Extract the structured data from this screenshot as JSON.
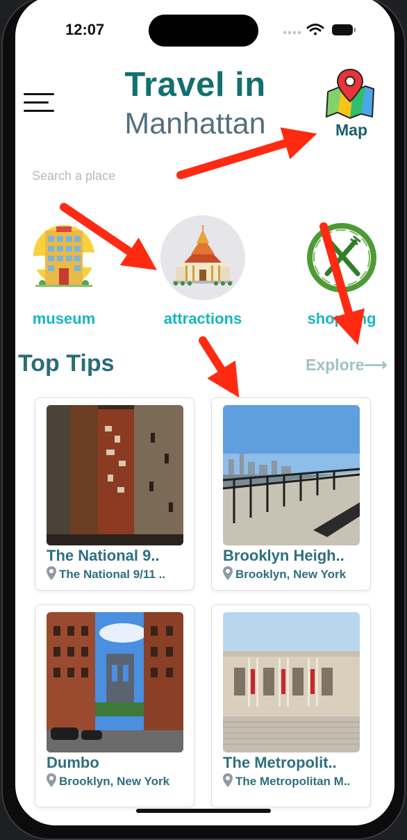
{
  "status": {
    "time": "12:07"
  },
  "header": {
    "title_line1": "Travel in",
    "title_line2": "Manhattan",
    "map_label": "Map"
  },
  "search": {
    "placeholder": "Search a place",
    "value": ""
  },
  "categories": [
    {
      "label": "museum",
      "icon": "hotel-icon"
    },
    {
      "label": "attractions",
      "icon": "temple-icon"
    },
    {
      "label": "shopping",
      "icon": "fork-knife-icon"
    }
  ],
  "section": {
    "title": "Top Tips",
    "explore": "Explore⟶"
  },
  "cards": [
    {
      "name": "The National 9..",
      "location": "The National 9/11 .."
    },
    {
      "name": "Brooklyn Heigh..",
      "location": "Brooklyn, New York"
    },
    {
      "name": "Dumbo",
      "location": "Brooklyn, New York"
    },
    {
      "name": "The Metropolit..",
      "location": "The Metropolitan M.."
    }
  ],
  "colors": {
    "title": "#12706f",
    "accent": "#16b6c2",
    "annotation_arrows": "#ff2a12"
  }
}
